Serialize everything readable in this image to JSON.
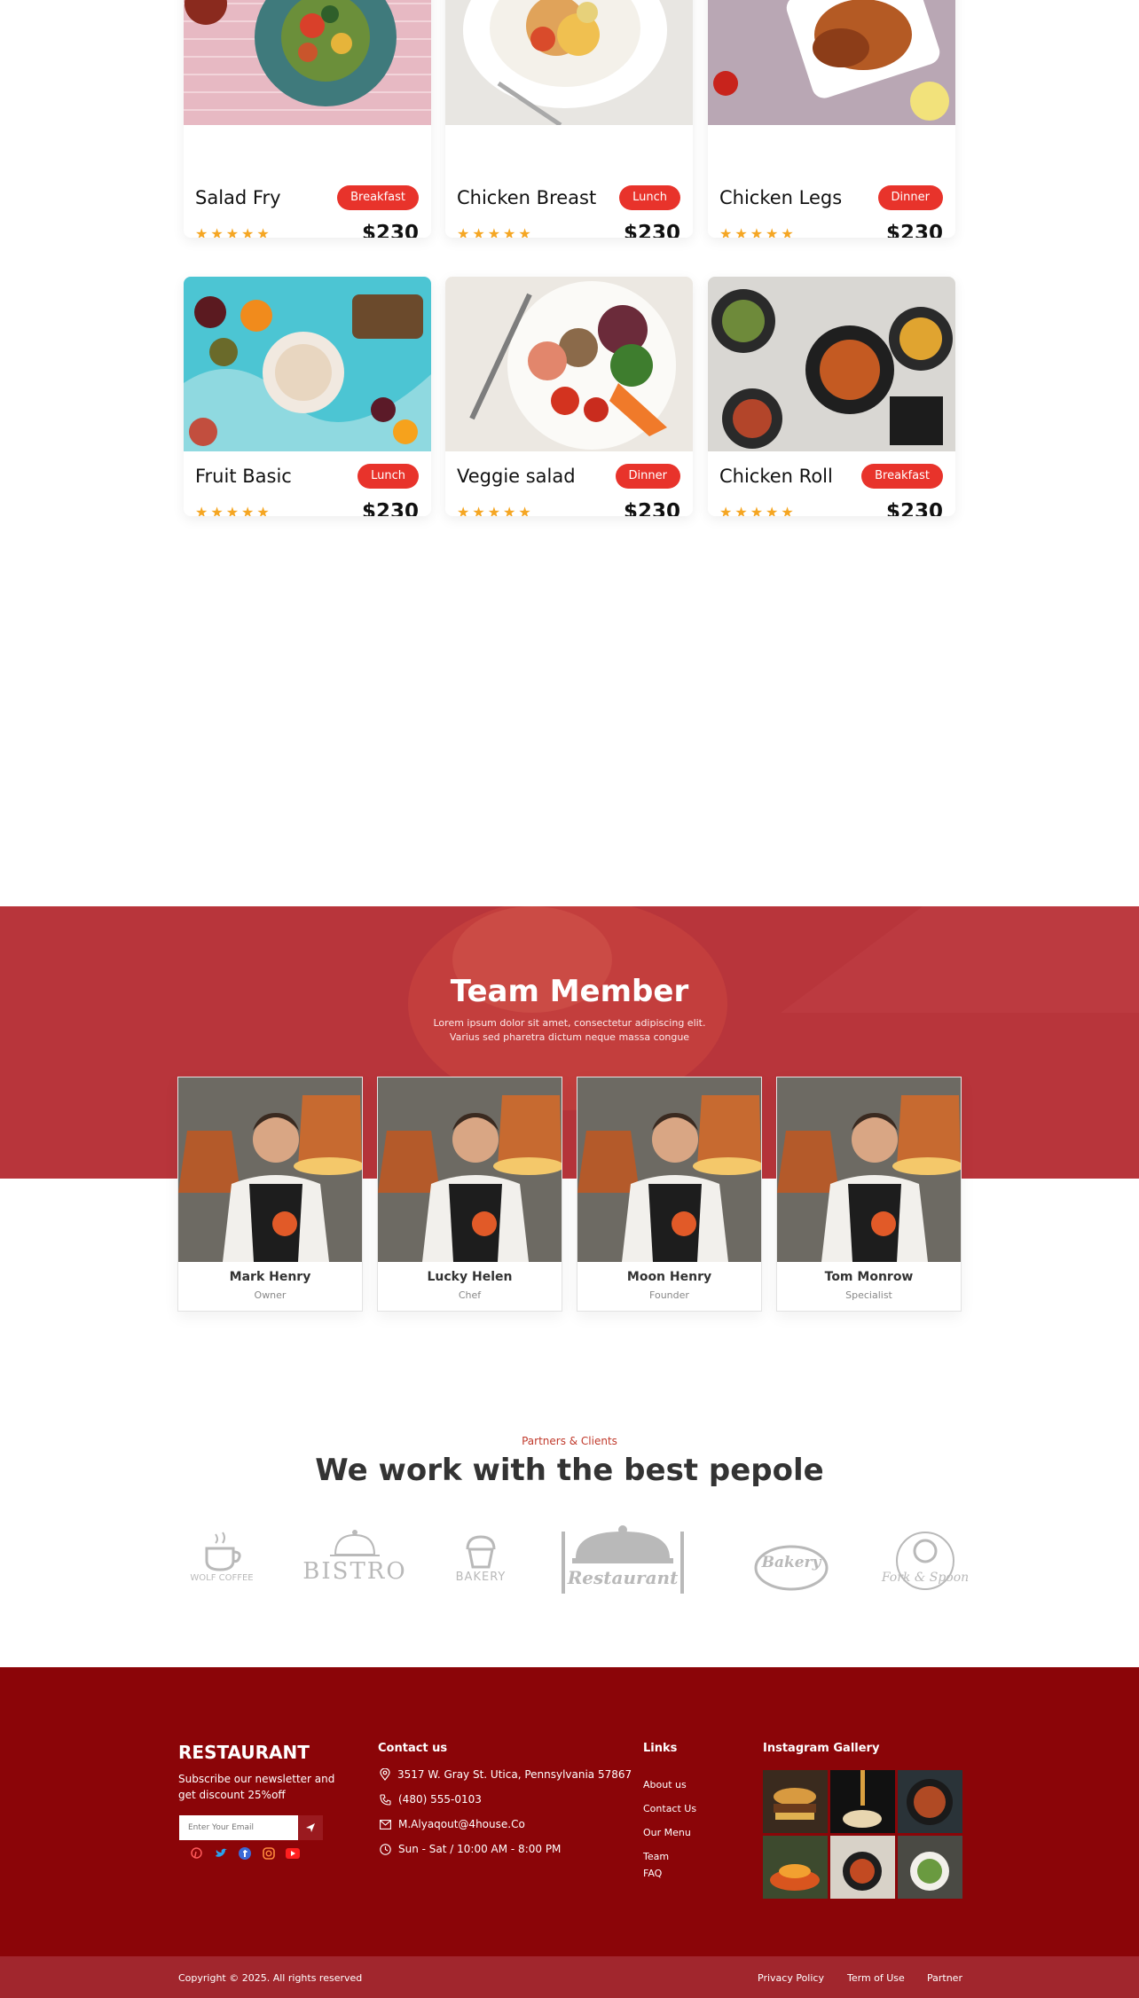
{
  "menu": {
    "items": [
      {
        "name": "Salad Fry",
        "tag": "Breakfast",
        "stars": "★★★★★",
        "price": "$230"
      },
      {
        "name": "Chicken Breast",
        "tag": "Lunch",
        "stars": "★★★★★",
        "price": "$230"
      },
      {
        "name": "Chicken Legs",
        "tag": "Dinner",
        "stars": "★★★★★",
        "price": "$230"
      },
      {
        "name": "Fruit Basic",
        "tag": "Lunch",
        "stars": "★★★★★",
        "price": "$230"
      },
      {
        "name": "Veggie salad",
        "tag": "Dinner",
        "stars": "★★★★★",
        "price": "$230"
      },
      {
        "name": "Chicken Roll",
        "tag": "Breakfast",
        "stars": "★★★★★",
        "price": "$230"
      }
    ]
  },
  "team": {
    "title": "Team Member",
    "desc_line1": "Lorem ipsum dolor sit amet, consectetur adipiscing elit.",
    "desc_line2": "Varius sed pharetra dictum neque massa congue",
    "members": [
      {
        "name": "Mark Henry",
        "role": "Owner"
      },
      {
        "name": "Lucky Helen",
        "role": "Chef"
      },
      {
        "name": "Moon Henry",
        "role": "Founder"
      },
      {
        "name": "Tom Monrow",
        "role": "Specialist"
      }
    ]
  },
  "partners": {
    "label": "Partners & Clients",
    "title": "We work with the best pepole",
    "logos": [
      "WOLF COFFEE",
      "BISTRO",
      "BAKERY",
      "Restaurant",
      "Bakery",
      "Fork & Spoon"
    ]
  },
  "footer": {
    "brand": "RESTAURANT",
    "subscribe_text": "Subscribe our newsletter and get discount 25%off",
    "email_placeholder": "Enter Your Email",
    "contact_heading": "Contact us",
    "address": "3517 W. Gray St. Utica, Pennsylvania 57867",
    "phone": "(480) 555-0103",
    "email": "M.Alyaqout@4house.Co",
    "hours": "Sun - Sat / 10:00 AM - 8:00 PM",
    "links_heading": "Links",
    "links": [
      "About us",
      "Contact Us",
      "Our Menu",
      "Team",
      "FAQ"
    ],
    "gallery_heading": "Instagram Gallery",
    "copyright": "Copyright © 2025. All rights reserved",
    "bottom_links": [
      "Privacy Policy",
      "Term of Use",
      "Partner"
    ]
  },
  "colors": {
    "accent": "#e8332b",
    "team_band": "#b8353b",
    "footer_bg": "#8b0508",
    "footer_bottom": "#a1262d",
    "star": "#f5a623"
  }
}
